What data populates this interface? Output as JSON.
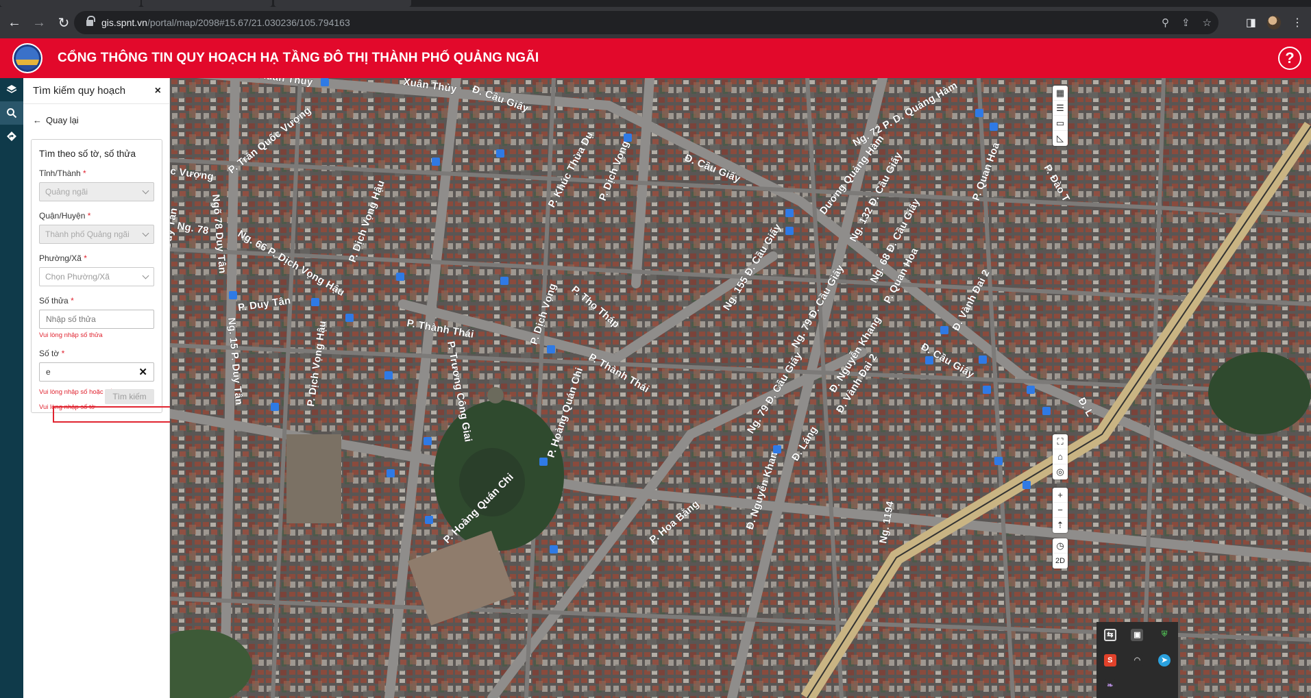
{
  "browser": {
    "url_host": "gis.spnt.vn",
    "url_path": "/portal/map/2098#15.67/21.030236/105.794163"
  },
  "header": {
    "title": "CỔNG THÔNG TIN QUY HOẠCH HẠ TẦNG ĐÔ THỊ THÀNH PHỐ QUẢNG NGÃI",
    "help_label": "?"
  },
  "panel": {
    "title": "Tìm kiếm quy hoạch",
    "close_label": "×",
    "back_label": "Quay lại",
    "card_title": "Tìm theo số tờ, số thửa",
    "province": {
      "label": "Tỉnh/Thành",
      "required": "*",
      "value": "Quảng ngãi"
    },
    "district": {
      "label": "Quận/Huyện",
      "required": "*",
      "value": "Thành phố Quảng ngãi"
    },
    "ward": {
      "label": "Phường/Xã",
      "required": "*",
      "value": "Chọn Phường/Xã"
    },
    "parcel": {
      "label": "Số thửa",
      "required": "*",
      "placeholder": "Nhập số thửa",
      "error": "Vui lòng nhập số thửa"
    },
    "sheet": {
      "label": "Số tờ",
      "required": "*",
      "value": "e",
      "clear_label": "✕",
      "error_format": "Vui lòng nhập số hoặc số thập phân",
      "error_required": "Vui lòng nhập số tờ"
    },
    "search_button": "Tìm kiếm"
  },
  "map": {
    "streets": [
      "Xuân Thủy",
      "Xuân Thủy",
      "Đ. Cầu Giấy",
      "c Vượng",
      "P. Trần Quốc Vượng",
      "P. Khúc Thừa Dụ",
      "P. Dịch Vọng",
      "Đ. Cầu Giấy",
      "Dương Quảng Hàm",
      "Ng. 132 Đ. Cầu Giấy",
      "Ng. 72 P. D. Quảng Hàm",
      "P. Quan Hoa",
      "P. Đào T",
      "Ngõ 78 Duy Tân",
      "Ng. 78",
      "Duy Tân",
      "Ng. 66 P. Dịch Vọng Hậu",
      "P. Dịch Vọng Hậu",
      "P. Duy Tân",
      "Ng. 15 P. Duy Tân",
      "Ng. 155 Đ. Cầu Giấy",
      "Ng. 68 Đ. Cầu Giấy",
      "P. Quan Hoa",
      "Đ. Vành Đai 2",
      "P. Dịch Vọng",
      "P. Thọ Tháp",
      "P. Thành Thái",
      "P. Trương Công Giai",
      "P. Thành Thái",
      "P. Dịch Vọng Hậu",
      "P. Hoàng Quán Chi",
      "Đ. Cầu Giấy",
      "Ng. 79 Đ. Cầu Giấy",
      "Đ. Nguyễn Khang",
      "Đ. Vành Đai 2",
      "Ng. 79 Đ. Cầu Giấy",
      "Đ. Láng",
      "P. Hoàng Quán Chi",
      "P. Hoa Bằng",
      "Đ. Nguyễn Khang",
      "Ng. 1194",
      "Đ. L"
    ],
    "tools_top": [
      "map-icon",
      "list-icon",
      "ruler-icon",
      "angle-icon"
    ],
    "tools_bottom": [
      "fullscreen-icon",
      "home-icon",
      "locate-icon",
      "zoom-in-icon",
      "zoom-out-icon",
      "compass-icon",
      "clock-icon"
    ],
    "mode_label": "2D",
    "zoom_in": "+",
    "zoom_out": "−"
  },
  "colors": {
    "header": "#e2092b",
    "rail": "#0f3a4a",
    "error": "#e0232f"
  }
}
